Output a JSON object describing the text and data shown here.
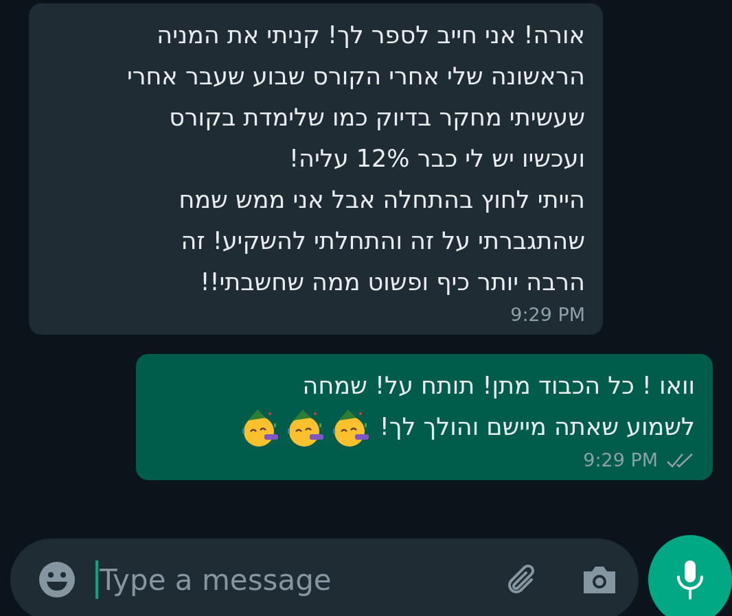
{
  "messages": [
    {
      "kind": "incoming",
      "text": "אורה! אני חייב לספר לך! קניתי את המניה\nהראשונה שלי אחרי הקורס שבוע שעבר אחרי\nשעשיתי מחקר בדיוק כמו שלימדת בקורס\nועכשיו יש לי כבר 12% עליה!\nהייתי לחוץ בהתחלה אבל אני ממש שמח\nשהתגברתי על זה והתחלתי להשקיע! זה\nהרבה יותר כיף ופשוט ממה שחשבתי!!",
      "time": "9:29 PM"
    },
    {
      "kind": "outgoing",
      "text": "וואו ! כל הכבוד מתן! תותח על! שמחה\nלשמוע שאתה מיישם והולך לך!",
      "emojis": [
        {
          "kind": "party-face"
        },
        {
          "kind": "party-face"
        },
        {
          "kind": "party-face"
        }
      ],
      "time": "9:29 PM",
      "read": false
    }
  ],
  "composer": {
    "placeholder": "Type a message",
    "focused": true
  }
}
